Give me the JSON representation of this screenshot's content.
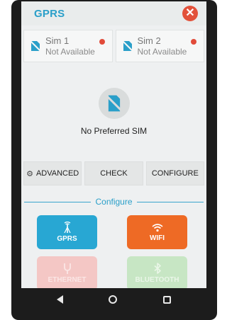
{
  "appbar": {
    "title": "GPRS",
    "close_glyph": "✕"
  },
  "sims": [
    {
      "name": "Sim 1",
      "status": "Not Available",
      "indicator_color": "#e14b3a"
    },
    {
      "name": "Sim 2",
      "status": "Not Available",
      "indicator_color": "#e14b3a"
    }
  ],
  "preferred": {
    "label": "No Preferred SIM",
    "icon": "sim-card-off-icon"
  },
  "actions": {
    "advanced": "ADVANCED",
    "check": "CHECK",
    "configure": "CONFIGURE"
  },
  "configure_section": {
    "title": "Configure",
    "tiles": [
      {
        "label": "GPRS",
        "icon": "antenna-icon",
        "color": "#28a7d3"
      },
      {
        "label": "WIFI",
        "icon": "wifi-icon",
        "color": "#ee6a25"
      },
      {
        "label": "ETHERNET",
        "icon": "ethernet-icon",
        "color": "#f4c7c5"
      },
      {
        "label": "BLUETOOTH",
        "icon": "bluetooth-icon",
        "color": "#c7e6c4"
      }
    ]
  },
  "colors": {
    "accent": "#2a9fc9",
    "close": "#e2513a"
  }
}
